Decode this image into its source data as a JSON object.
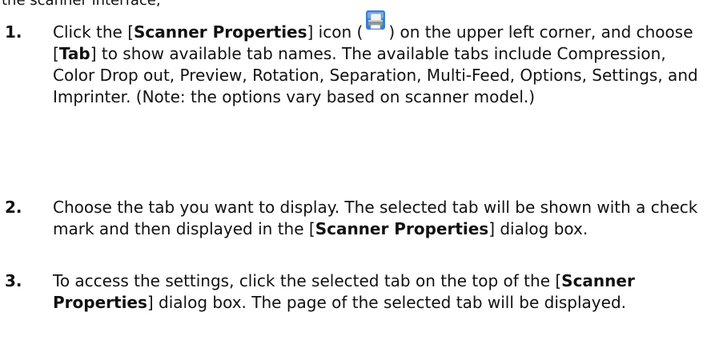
{
  "header_fragment": "the scanner interface,",
  "steps": [
    {
      "number": "1.",
      "t1": "Click the [",
      "b1": "Scanner Properties",
      "t2": "] icon (",
      "icon": "scanner-properties-icon",
      "t3": ") on the upper left corner, and choose [",
      "b2": "Tab",
      "t4": "] to show available tab names. The available tabs include Compression, Color Drop out, Preview, Rotation, Separation, Multi-Feed, Options, Settings, and Imprinter. (Note: the options vary based on scanner model.)"
    },
    {
      "number": "2.",
      "t1": "Choose the tab you want to display. The selected tab will be shown with a check mark and then displayed in the [",
      "b1": "Scanner Properties",
      "t2": "] dialog box."
    },
    {
      "number": "3.",
      "t1": "To access the settings, click the selected tab on the top of the [",
      "b1": "Scanner Properties",
      "t2": "] dialog box. The page of the selected tab will be displayed."
    }
  ]
}
